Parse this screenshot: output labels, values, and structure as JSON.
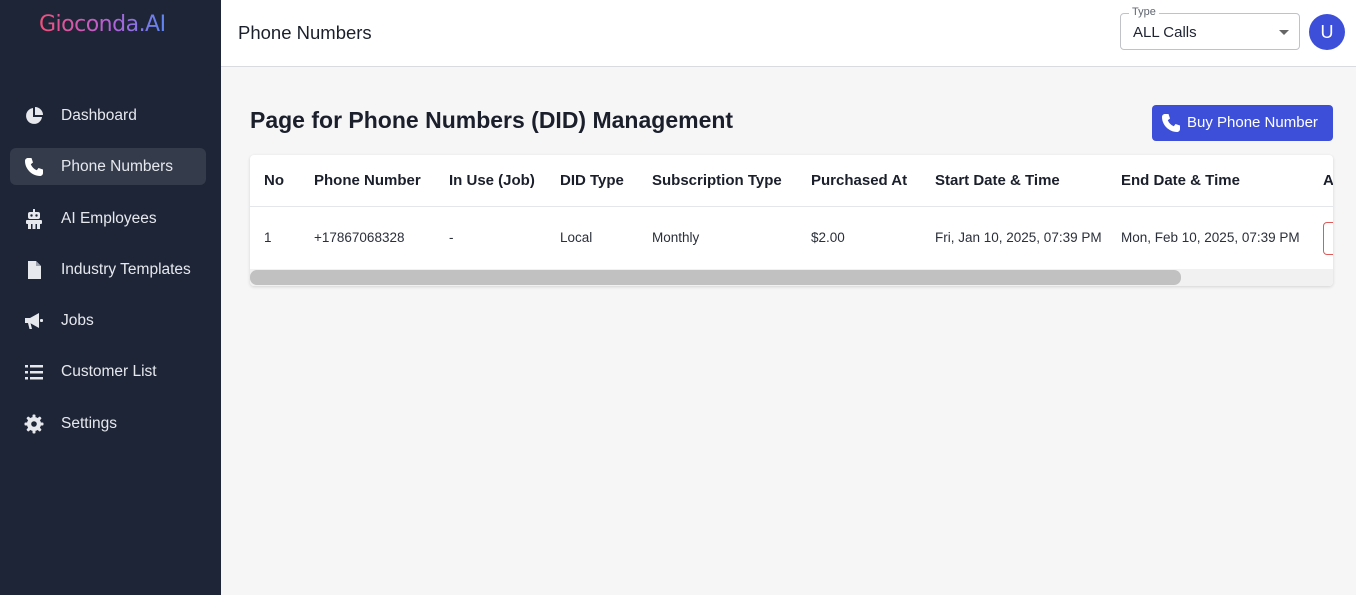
{
  "app": {
    "logo_text": "Gioconda.AI"
  },
  "sidebar": {
    "items": [
      {
        "label": "Dashboard",
        "icon": "pie-chart-icon",
        "active": false
      },
      {
        "label": "Phone Numbers",
        "icon": "phone-icon",
        "active": true
      },
      {
        "label": "AI Employees",
        "icon": "robot-icon",
        "active": false
      },
      {
        "label": "Industry Templates",
        "icon": "file-icon",
        "active": false
      },
      {
        "label": "Jobs",
        "icon": "megaphone-icon",
        "active": false
      },
      {
        "label": "Customer List",
        "icon": "list-icon",
        "active": false
      },
      {
        "label": "Settings",
        "icon": "gear-icon",
        "active": false
      }
    ]
  },
  "header": {
    "title": "Phone Numbers",
    "type_filter": {
      "label": "Type",
      "value": "ALL Calls"
    },
    "avatar_initial": "U"
  },
  "main": {
    "heading": "Page for Phone Numbers (DID) Management",
    "buy_button_label": "Buy Phone Number",
    "table": {
      "columns": [
        "No",
        "Phone Number",
        "In Use (Job)",
        "DID Type",
        "Subscription Type",
        "Purchased At",
        "Start Date & Time",
        "End Date & Time",
        "A"
      ],
      "rows": [
        [
          "1",
          "+17867068328",
          "-",
          "Local",
          "Monthly",
          "$2.00",
          "Fri, Jan 10, 2025, 07:39 PM",
          "Mon, Feb 10, 2025, 07:39 PM"
        ]
      ],
      "scroll_position": 0.0
    }
  },
  "colors": {
    "sidebar_bg": "#1e2536",
    "sidebar_active_bg": "#343b4b",
    "accent": "#3d4fd9",
    "page_bg": "#f6f6f7",
    "danger": "#e05a5a"
  }
}
